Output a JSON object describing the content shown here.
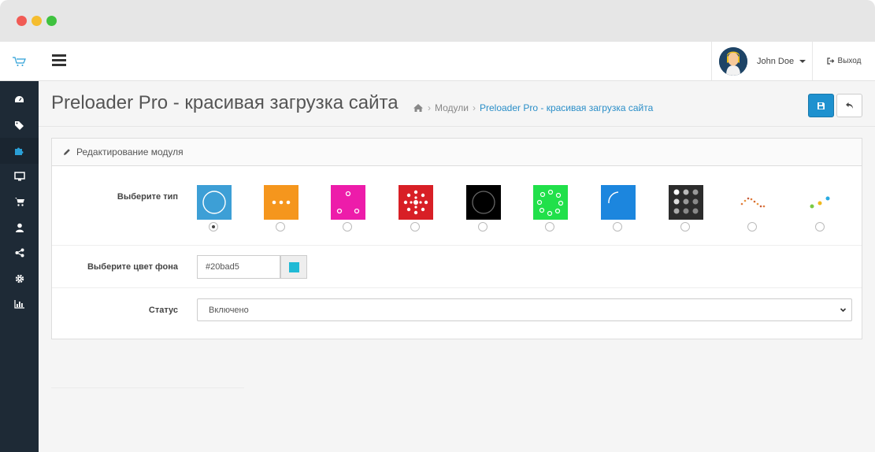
{
  "header": {
    "user_name": "John Doe",
    "logout_label": "Выход"
  },
  "sidebar": {
    "items": [
      {
        "icon": "dashboard-icon"
      },
      {
        "icon": "tags-icon"
      },
      {
        "icon": "puzzle-icon"
      },
      {
        "icon": "desktop-icon"
      },
      {
        "icon": "shopping-cart-icon"
      },
      {
        "icon": "user-icon"
      },
      {
        "icon": "share-icon"
      },
      {
        "icon": "gear-icon"
      },
      {
        "icon": "bar-chart-icon"
      }
    ]
  },
  "page": {
    "title": "Preloader Pro - красивая загрузка сайта",
    "breadcrumb": [
      {
        "label": "Модули"
      },
      {
        "label": "Preloader Pro - красивая загрузка сайта"
      }
    ]
  },
  "panel": {
    "heading": "Редактирование модуля",
    "type_label": "Выберите тип",
    "types": [
      {
        "color": "#3d9fd6",
        "style": "ring",
        "selected": true
      },
      {
        "color": "#f5961d",
        "style": "dots3",
        "selected": false
      },
      {
        "color": "#ed1caa",
        "style": "corner-dots",
        "selected": false
      },
      {
        "color": "#d81f26",
        "style": "dot-circle",
        "selected": false
      },
      {
        "color": "#000000",
        "style": "dark-ring",
        "selected": false
      },
      {
        "color": "#21e04a",
        "style": "ring-dots",
        "selected": false
      },
      {
        "color": "#1c86de",
        "style": "arc",
        "selected": false
      },
      {
        "color": "#2c2c2c",
        "style": "grid",
        "selected": false
      },
      {
        "color": "#ffffff",
        "style": "wave-dots",
        "selected": false
      },
      {
        "color": "#ffffff",
        "style": "color-dots",
        "selected": false
      }
    ],
    "bg_color_label": "Выберите цвет фона",
    "bg_color_value": "#20bad5",
    "status_label": "Статус",
    "status_value": "Включено"
  },
  "colors": {
    "accent": "#1e91cf",
    "sidebar_bg": "#1e2a36",
    "link": "#2a8ec8"
  }
}
